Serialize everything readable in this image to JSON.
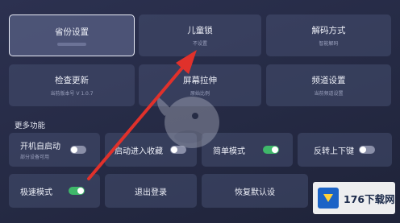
{
  "top_tiles": [
    {
      "label": "省份设置",
      "sub": "",
      "selected": true
    },
    {
      "label": "儿童锁",
      "sub": "不设置",
      "selected": false
    },
    {
      "label": "解码方式",
      "sub": "智能解码",
      "selected": false
    }
  ],
  "second_tiles": [
    {
      "label": "检查更新",
      "sub": "当前版本号 V 1.0.7"
    },
    {
      "label": "屏幕拉伸",
      "sub": "原始比例"
    },
    {
      "label": "频道设置",
      "sub": "当前频道设置"
    }
  ],
  "section_title": "更多功能",
  "toggle_tiles": [
    {
      "label": "开机自启动",
      "sub": "部分设备可用",
      "on": false
    },
    {
      "label": "启动进入收藏",
      "sub": "",
      "on": false
    },
    {
      "label": "简单模式",
      "sub": "",
      "on": true
    },
    {
      "label": "反转上下键",
      "sub": "",
      "on": false
    }
  ],
  "bottom_tiles": [
    {
      "label": "极速模式",
      "on": true
    },
    {
      "label": "退出登录"
    },
    {
      "label": "恢复默认设"
    }
  ],
  "watermark": {
    "text": "176下载网"
  },
  "colors": {
    "accent_on": "#3fb86a",
    "arrow": "#e0312b",
    "toggle_off": "#8a8fa8"
  }
}
